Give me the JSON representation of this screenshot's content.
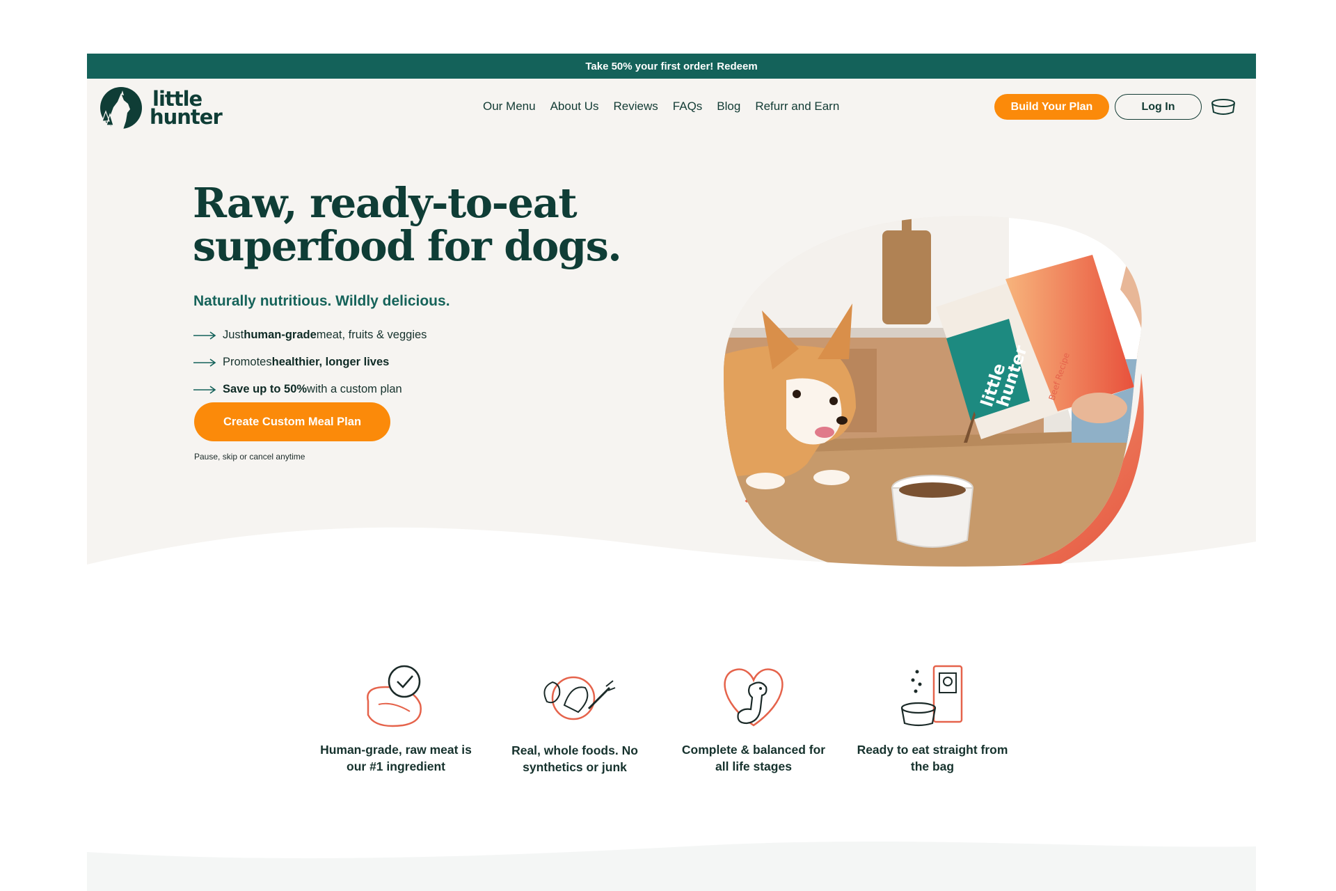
{
  "announcement": {
    "text": "Take 50% your first order!",
    "link": "Redeem"
  },
  "brand": {
    "line1": "little",
    "line2": "hunter"
  },
  "nav": [
    "Our Menu",
    "About Us",
    "Reviews",
    "FAQs",
    "Blog",
    "Refurr and Earn"
  ],
  "header_buttons": {
    "build": "Build Your Plan",
    "login": "Log In"
  },
  "hero": {
    "headline": "Raw, ready-to-eat superfood for dogs.",
    "subheadline": "Naturally nutritious. Wildly delicious.",
    "bullets": [
      {
        "pre": "Just ",
        "bold": "human-grade",
        "post": " meat, fruits & veggies"
      },
      {
        "pre": "Promotes ",
        "bold": "healthier, longer lives",
        "post": ""
      },
      {
        "pre": "",
        "bold": "Save up to 50%",
        "post": " with a custom plan"
      }
    ],
    "cta": "Create Custom Meal Plan",
    "cta_note": "Pause, skip or cancel anytime"
  },
  "product_bag": {
    "line1": "little",
    "line2": "hunter",
    "recipe": "Beef Recipe"
  },
  "features": [
    {
      "icon": "raw-meat-badge-icon",
      "caption": "Human-grade, raw meat is our #1 ingredient"
    },
    {
      "icon": "whole-foods-icon",
      "caption": "Real, whole foods. No synthetics or junk"
    },
    {
      "icon": "dog-heart-icon",
      "caption": "Complete & balanced for all life stages"
    },
    {
      "icon": "bag-and-bowl-icon",
      "caption": "Ready to eat straight from the bag"
    }
  ],
  "colors": {
    "brand_green": "#14625a",
    "dark_green": "#0f3d36",
    "accent_orange": "#fb8a0a",
    "hero_bg": "#f6f4f1",
    "coral": "#e5634b"
  }
}
